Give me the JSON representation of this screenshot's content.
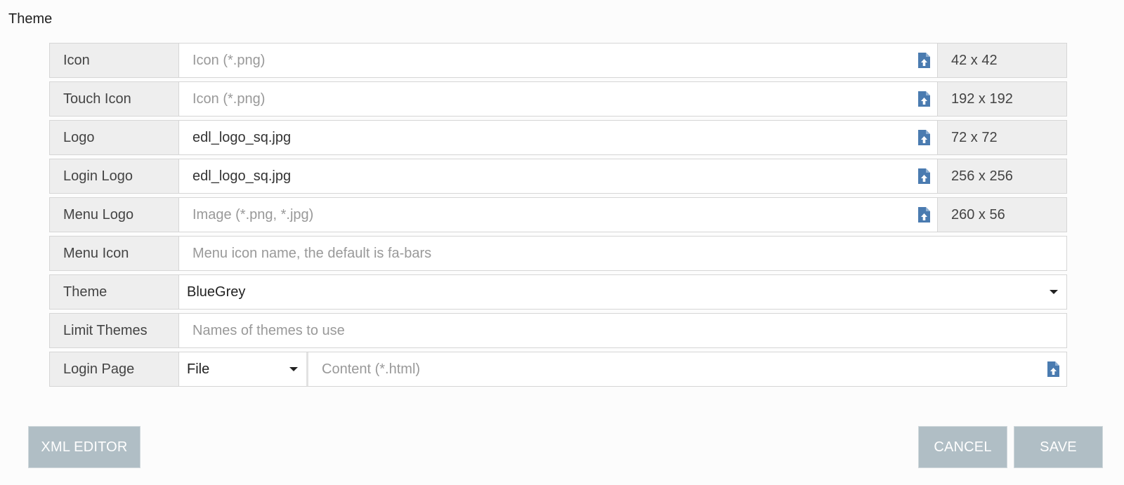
{
  "section": {
    "title": "Theme"
  },
  "rows": [
    {
      "label": "Icon",
      "placeholder": "Icon (*.png)",
      "value": "",
      "size": "42 x 42"
    },
    {
      "label": "Touch Icon",
      "placeholder": "Icon (*.png)",
      "value": "",
      "size": "192 x 192"
    },
    {
      "label": "Logo",
      "placeholder": "",
      "value": "edl_logo_sq.jpg",
      "size": "72 x 72"
    },
    {
      "label": "Login Logo",
      "placeholder": "",
      "value": "edl_logo_sq.jpg",
      "size": "256 x 256"
    },
    {
      "label": "Menu Logo",
      "placeholder": "Image (*.png, *.jpg)",
      "value": "",
      "size": "260 x 56"
    },
    {
      "label": "Menu Icon",
      "placeholder": "Menu icon name, the default is fa-bars",
      "value": ""
    },
    {
      "label": "Theme",
      "value": "BlueGrey"
    },
    {
      "label": "Limit Themes",
      "placeholder": "Names of themes to use",
      "value": ""
    },
    {
      "label": "Login Page",
      "select_value": "File",
      "placeholder": "Content (*.html)",
      "value": ""
    }
  ],
  "buttons": {
    "xml_editor": "XML EDITOR",
    "cancel": "CANCEL",
    "save": "SAVE"
  },
  "colors": {
    "accent_icon": "#4a7bb0",
    "button_bg": "#b0bec5",
    "label_bg": "#eeeeee"
  },
  "icons": {
    "upload": "file-upload-icon",
    "dropdown": "chevron-down-icon"
  }
}
